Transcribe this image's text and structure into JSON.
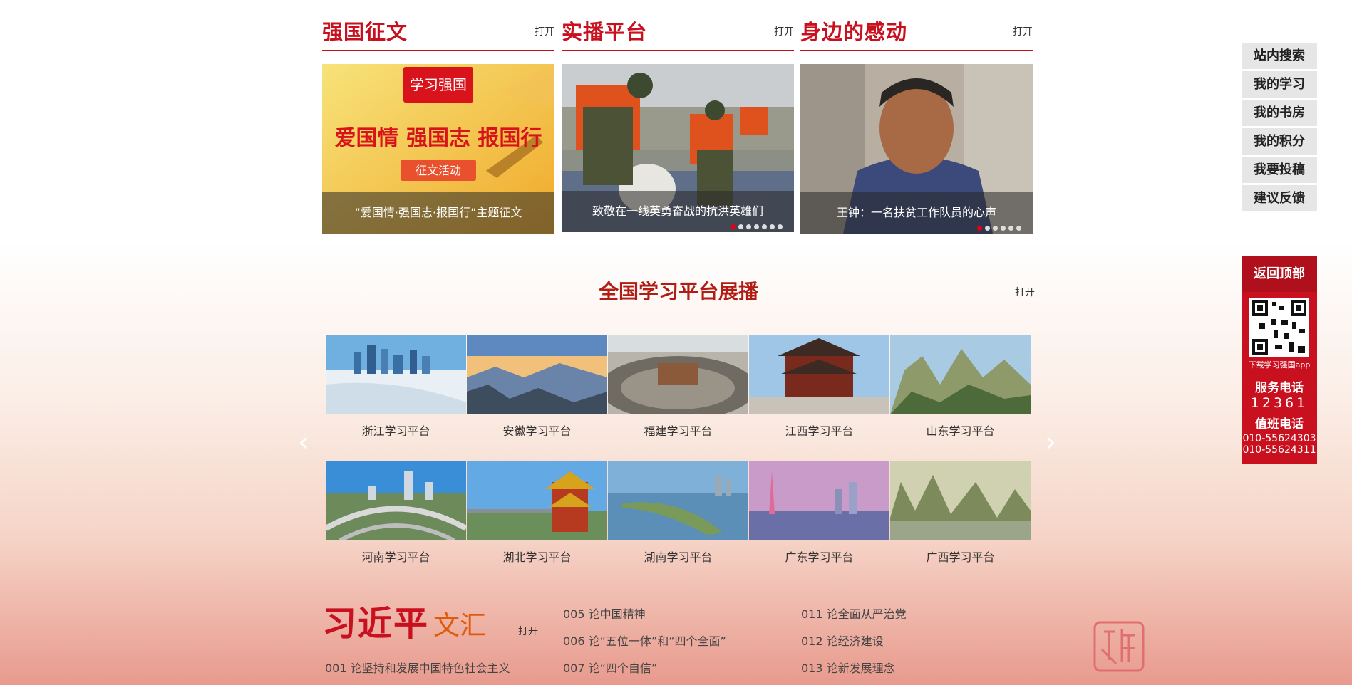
{
  "sections": [
    {
      "title": "强国征文",
      "open": "打开",
      "caption": "“爱国情·强国志·报国行”主题征文",
      "banner": {
        "logo": "学习强国",
        "line1": "爱国情 强国志 报国行",
        "line2": "征文活动"
      }
    },
    {
      "title": "实播平台",
      "open": "打开",
      "caption": "致敬在一线英勇奋战的抗洪英雄们"
    },
    {
      "title": "身边的感动",
      "open": "打开",
      "caption": "王钟：一名扶贫工作队员的心声"
    }
  ],
  "showcase": {
    "title": "全国学习平台展播",
    "open": "打开",
    "row1": [
      "浙江学习平台",
      "安徽学习平台",
      "福建学习平台",
      "江西学习平台",
      "山东学习平台"
    ],
    "row2": [
      "河南学习平台",
      "湖北学习平台",
      "湖南学习平台",
      "广东学习平台",
      "广西学习平台"
    ]
  },
  "wenhui": {
    "title": "习近平",
    "subtitle": "文汇",
    "open": "打开",
    "col1": [
      "001 论坚持和发展中国特色社会主义"
    ],
    "col2": [
      "005 论中国精神",
      "006 论“五位一体”和“四个全面”",
      "007 论“四个自信”"
    ],
    "col3": [
      "011 论全面从严治党",
      "012 论经济建设",
      "013 论新发展理念"
    ]
  },
  "sidebar": {
    "buttons": [
      "站内搜索",
      "我的学习",
      "我的书房",
      "我的积分",
      "我要投稿",
      "建议反馈"
    ],
    "back_top": "返回顶部",
    "download": "下载学习强国app",
    "service_label": "服务电话",
    "service_number": "12361",
    "duty_label": "值班电话",
    "duty_numbers": [
      "010-55624303",
      "010-55624311"
    ]
  },
  "colors": {
    "brand_red": "#c8101f",
    "accent_orange": "#e05a0c"
  }
}
